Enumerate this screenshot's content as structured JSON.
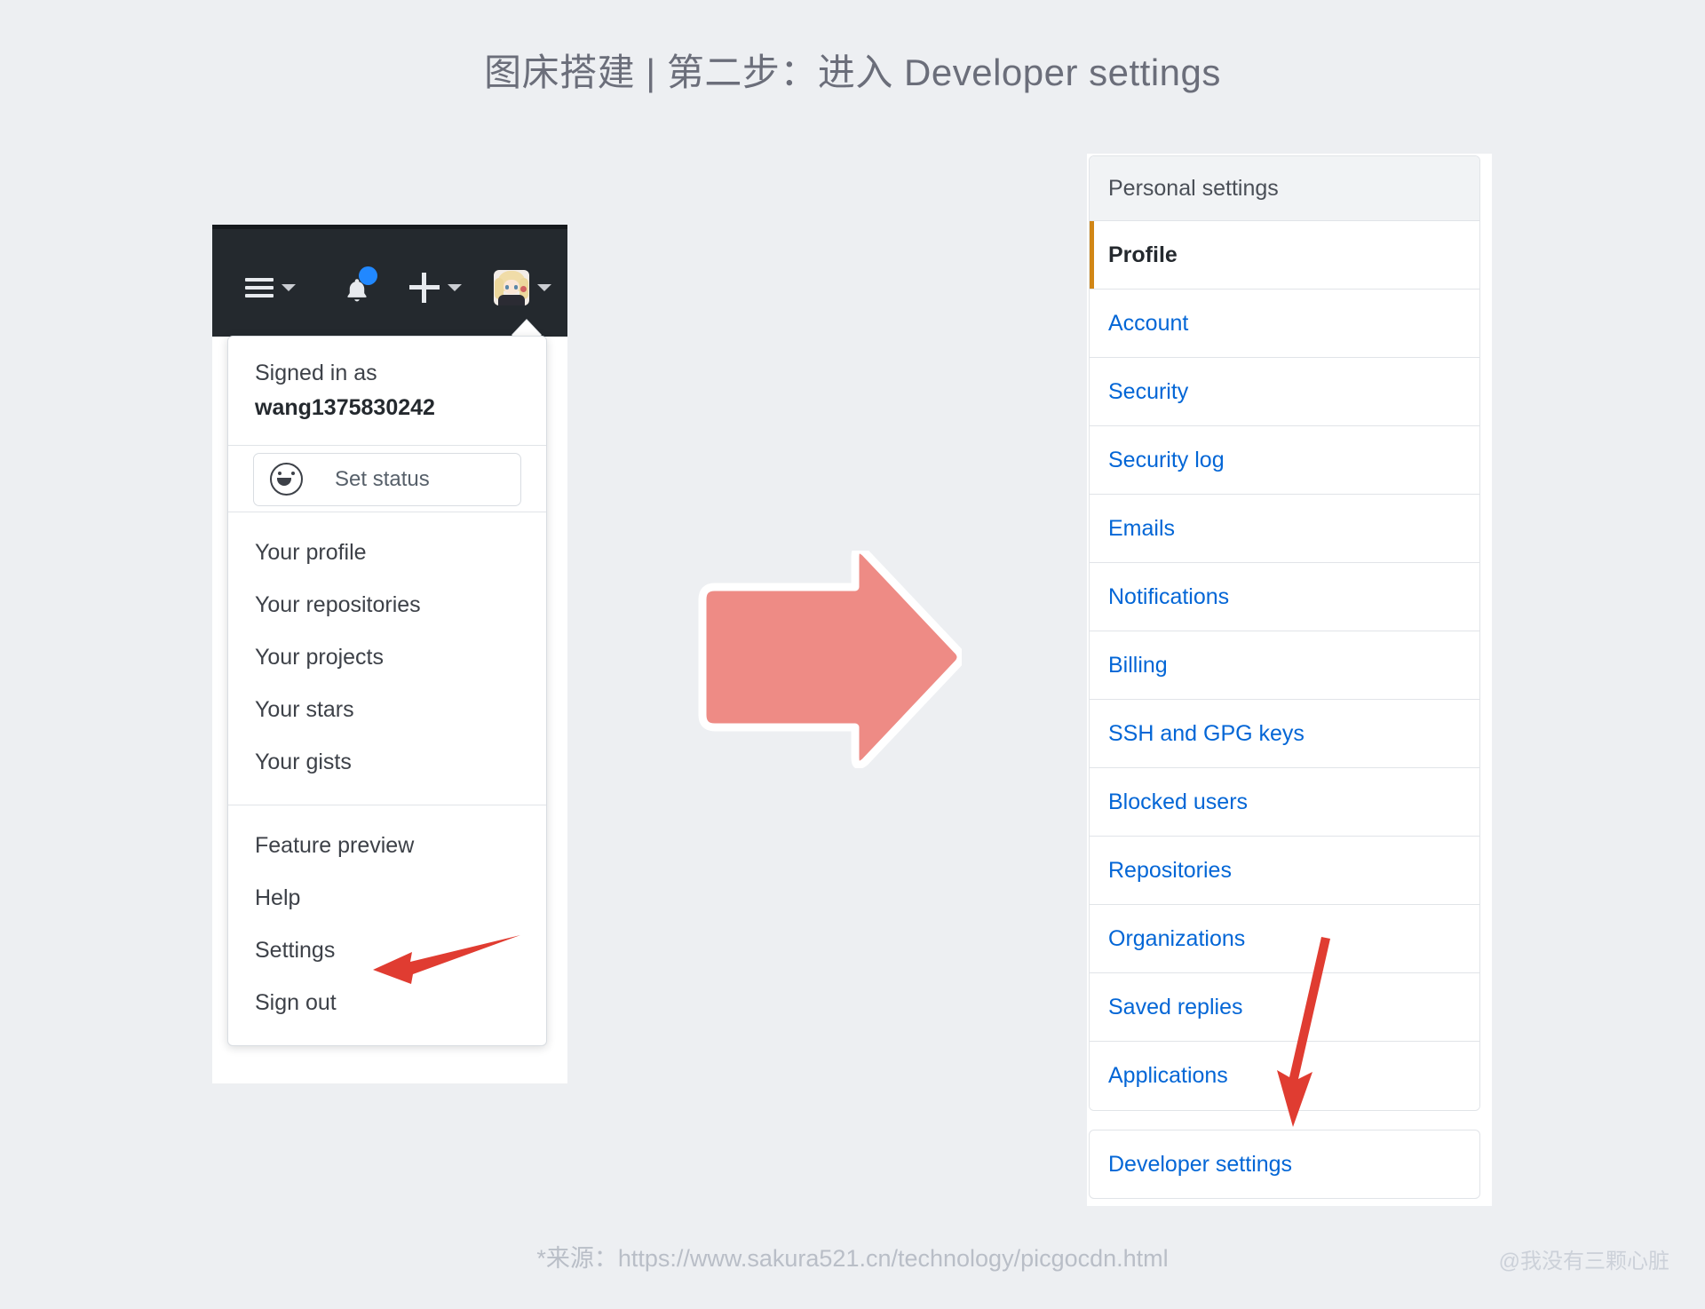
{
  "page": {
    "title": "图床搭建 | 第二步：进入 Developer settings",
    "source_note": "*来源：https://www.sakura521.cn/technology/picgocdn.html",
    "watermark": "@我没有三颗心脏",
    "background_color": "#edeff2"
  },
  "github_nav": {
    "background_color": "#24292e",
    "hamburger_icon": "hamburger-menu-icon",
    "notification_icon": "bell-icon",
    "notification_dot_color": "#2188ff",
    "create_new_icon": "plus-icon",
    "avatar_icon": "user-avatar"
  },
  "dropdown": {
    "signed_in_label": "Signed in as",
    "username": "wang1375830242",
    "set_status": {
      "icon": "smiley-icon",
      "label": "Set status"
    },
    "group_one": [
      {
        "label": "Your profile"
      },
      {
        "label": "Your repositories"
      },
      {
        "label": "Your projects"
      },
      {
        "label": "Your stars"
      },
      {
        "label": "Your gists"
      }
    ],
    "group_two": [
      {
        "label": "Feature preview"
      },
      {
        "label": "Help"
      },
      {
        "label": "Settings"
      },
      {
        "label": "Sign out"
      }
    ]
  },
  "annotations": {
    "big_arrow": {
      "name": "step-flow-arrow",
      "color": "#ee8b85",
      "outline": "#ffffff",
      "direction": "right"
    },
    "settings_arrow": {
      "name": "settings-pointer-arrow",
      "color": "#e03c31",
      "direction": "left"
    },
    "developer_arrow": {
      "name": "developer-settings-pointer-arrow",
      "color": "#e03c31",
      "direction": "down"
    }
  },
  "settings_sidebar": {
    "header": "Personal settings",
    "selected_accent_color": "#d18616",
    "link_color": "#0366d6",
    "items": [
      {
        "label": "Profile",
        "selected": true
      },
      {
        "label": "Account",
        "selected": false
      },
      {
        "label": "Security",
        "selected": false
      },
      {
        "label": "Security log",
        "selected": false
      },
      {
        "label": "Emails",
        "selected": false
      },
      {
        "label": "Notifications",
        "selected": false
      },
      {
        "label": "Billing",
        "selected": false
      },
      {
        "label": "SSH and GPG keys",
        "selected": false
      },
      {
        "label": "Blocked users",
        "selected": false
      },
      {
        "label": "Repositories",
        "selected": false
      },
      {
        "label": "Organizations",
        "selected": false
      },
      {
        "label": "Saved replies",
        "selected": false
      },
      {
        "label": "Applications",
        "selected": false
      }
    ],
    "developer_settings": "Developer settings"
  }
}
